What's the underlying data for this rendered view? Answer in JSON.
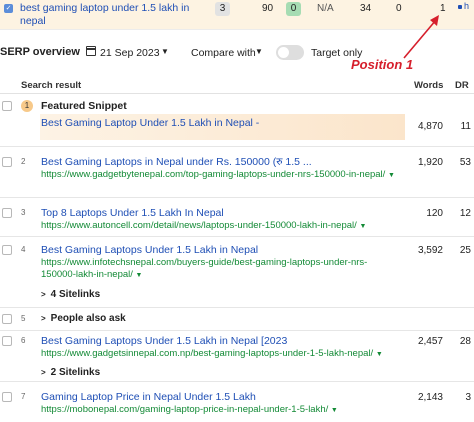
{
  "top_row": {
    "keyword": "best gaming laptop under 1.5 lakh in nepal",
    "pill_value": "3",
    "volume": "90",
    "kd": "0",
    "cpc": "N/A",
    "col5": "34",
    "col6": "0",
    "position": "1",
    "edge_text": "h"
  },
  "toolbar": {
    "title": "SERP overview",
    "date": "21 Sep 2023",
    "compare_label": "Compare with",
    "target_only_label": "Target only"
  },
  "annotation": {
    "label": "Position 1",
    "color": "#d61f2c"
  },
  "table": {
    "headers": {
      "result": "Search result",
      "words": "Words",
      "dr": "DR"
    },
    "featured": {
      "badge": "1",
      "label": "Featured Snippet",
      "title": "Best Gaming Laptop Under 1.5 Lakh in Nepal -",
      "words": "4,870",
      "dr": "11"
    },
    "rows": [
      {
        "pos": "2",
        "title": "Best Gaming Laptops in Nepal under Rs. 150000 (रु 1.5 ...",
        "url": "https://www.gadgetbytenepal.com/top-gaming-laptops-under-nrs-150000-in-nepal/",
        "words": "1,920",
        "dr": "53"
      },
      {
        "pos": "3",
        "title": "Top 8 Laptops Under 1.5 Lakh In Nepal",
        "url": "https://www.autoncell.com/detail/news/laptops-under-150000-lakh-in-nepal/",
        "words": "120",
        "dr": "12"
      },
      {
        "pos": "4",
        "title": "Best Gaming Laptops Under 1.5 Lakh in Nepal",
        "url": "https://www.infotechsnepal.com/buyers-guide/best-gaming-laptops-under-nrs-150000-lakh-in-nepal/",
        "words": "3,592",
        "dr": "25",
        "sitelinks": "4 Sitelinks"
      },
      {
        "pos": "5",
        "label": "People also ask"
      },
      {
        "pos": "6",
        "title": "Best Gaming Laptops Under 1.5 Lakh in Nepal [2023",
        "url": "https://www.gadgetsinnepal.com.np/best-gaming-laptops-under-1-5-lakh-nepal/",
        "words": "2,457",
        "dr": "28",
        "sitelinks": "2 Sitelinks"
      },
      {
        "pos": "7",
        "title": "Gaming Laptop Price in Nepal Under 1.5 Lakh",
        "url": "https://mobonepal.com/gaming-laptop-price-in-nepal-under-1-5-lakh/",
        "words": "2,143",
        "dr": "3"
      }
    ]
  },
  "colors": {
    "link": "#1f4fb5",
    "url": "#138a36",
    "highlight": "#fdf3e2"
  }
}
